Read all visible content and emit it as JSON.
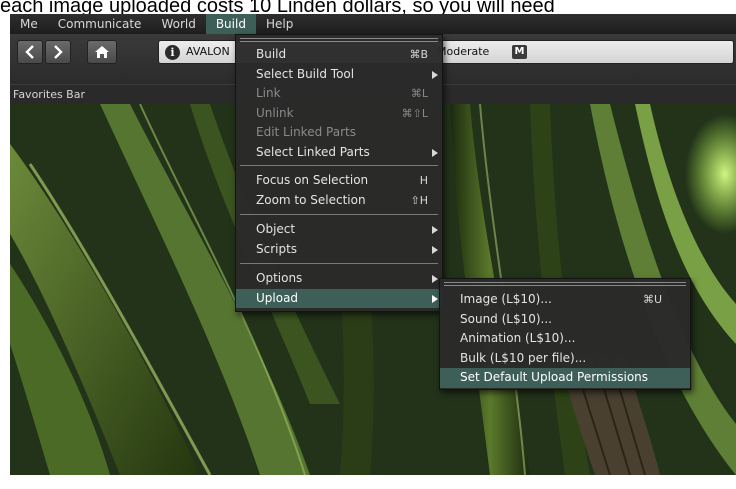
{
  "caption": "each image uploaded costs 10 Linden dollars, so you will need",
  "menubar": {
    "items": [
      "Me",
      "Communicate",
      "World",
      "Build",
      "Help"
    ],
    "active": "Build"
  },
  "navbar": {
    "back_icon": "chevron-left-icon",
    "forward_icon": "chevron-right-icon",
    "home_icon": "home-icon",
    "location": "AVALON",
    "maturity": "Moderate",
    "maturity_badge": "M"
  },
  "favorites": {
    "label": "Favorites Bar"
  },
  "build_menu": {
    "items": [
      {
        "label": "Build",
        "shortcut": "⌘B"
      },
      {
        "label": "Select Build Tool",
        "submenu": true
      },
      {
        "label": "Link",
        "shortcut": "⌘L",
        "disabled": true
      },
      {
        "label": "Unlink",
        "shortcut": "⌘⇧L",
        "disabled": true
      },
      {
        "label": "Edit Linked Parts",
        "disabled": true
      },
      {
        "label": "Select Linked Parts",
        "submenu": true
      },
      {
        "label": "Focus on Selection",
        "shortcut": "H"
      },
      {
        "label": "Zoom to Selection",
        "shortcut": "⇧H"
      },
      {
        "label": "Object",
        "submenu": true
      },
      {
        "label": "Scripts",
        "submenu": true
      },
      {
        "label": "Options",
        "submenu": true
      },
      {
        "label": "Upload",
        "submenu": true,
        "highlighted": true
      }
    ]
  },
  "upload_menu": {
    "items": [
      {
        "label": "Image (L$10)...",
        "shortcut": "⌘U"
      },
      {
        "label": "Sound (L$10)..."
      },
      {
        "label": "Animation (L$10)..."
      },
      {
        "label": "Bulk (L$10 per file)..."
      },
      {
        "label": "Set Default Upload Permissions",
        "highlighted": true
      }
    ]
  },
  "colors": {
    "highlight": "#3d5f57",
    "menu_bg": "#2a2a2a",
    "text": "#e4e4e4",
    "disabled_text": "#8a8a8a"
  }
}
